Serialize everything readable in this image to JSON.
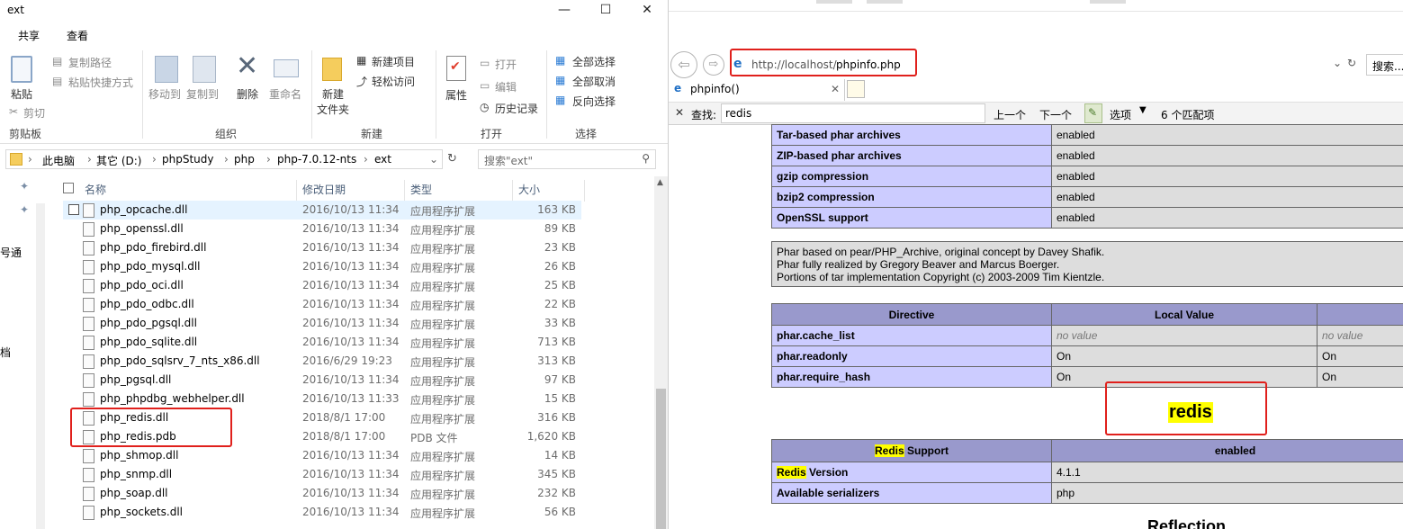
{
  "explorer": {
    "window_title": "ext",
    "window_controls": [
      "—",
      "☐",
      "✕"
    ],
    "ribbon_tabs": [
      "共享",
      "查看"
    ],
    "clipboard": {
      "paste": "粘贴",
      "copy_path": "复制路径",
      "paste_shortcut": "粘贴快捷方式",
      "cut": "剪切",
      "group": "剪贴板"
    },
    "organize": {
      "move_to": "移动到",
      "copy_to": "复制到",
      "delete": "删除",
      "rename": "重命名",
      "group": "组织"
    },
    "new": {
      "new_folder_line1": "新建",
      "new_folder_line2": "文件夹",
      "new_item": "新建项目",
      "easy_access": "轻松访问",
      "group": "新建"
    },
    "open": {
      "properties": "属性",
      "open": "打开",
      "edit": "编辑",
      "history": "历史记录",
      "group": "打开"
    },
    "select": {
      "select_all": "全部选择",
      "select_none": "全部取消",
      "invert": "反向选择",
      "group": "选择"
    },
    "breadcrumb": [
      "此电脑",
      "其它 (D:)",
      "phpStudy",
      "php",
      "php-7.0.12-nts",
      "ext"
    ],
    "search_placeholder": "搜索\"ext\"",
    "nav_fragments": [
      "号通",
      "档"
    ],
    "columns": {
      "name": "名称",
      "date": "修改日期",
      "type": "类型",
      "size": "大小"
    },
    "files": [
      {
        "name": "php_opcache.dll",
        "date": "2016/10/13 11:34",
        "type": "应用程序扩展",
        "size": "163 KB"
      },
      {
        "name": "php_openssl.dll",
        "date": "2016/10/13 11:34",
        "type": "应用程序扩展",
        "size": "89 KB"
      },
      {
        "name": "php_pdo_firebird.dll",
        "date": "2016/10/13 11:34",
        "type": "应用程序扩展",
        "size": "23 KB"
      },
      {
        "name": "php_pdo_mysql.dll",
        "date": "2016/10/13 11:34",
        "type": "应用程序扩展",
        "size": "26 KB"
      },
      {
        "name": "php_pdo_oci.dll",
        "date": "2016/10/13 11:34",
        "type": "应用程序扩展",
        "size": "25 KB"
      },
      {
        "name": "php_pdo_odbc.dll",
        "date": "2016/10/13 11:34",
        "type": "应用程序扩展",
        "size": "22 KB"
      },
      {
        "name": "php_pdo_pgsql.dll",
        "date": "2016/10/13 11:34",
        "type": "应用程序扩展",
        "size": "33 KB"
      },
      {
        "name": "php_pdo_sqlite.dll",
        "date": "2016/10/13 11:34",
        "type": "应用程序扩展",
        "size": "713 KB"
      },
      {
        "name": "php_pdo_sqlsrv_7_nts_x86.dll",
        "date": "2016/6/29 19:23",
        "type": "应用程序扩展",
        "size": "313 KB"
      },
      {
        "name": "php_pgsql.dll",
        "date": "2016/10/13 11:34",
        "type": "应用程序扩展",
        "size": "97 KB"
      },
      {
        "name": "php_phpdbg_webhelper.dll",
        "date": "2016/10/13 11:33",
        "type": "应用程序扩展",
        "size": "15 KB"
      },
      {
        "name": "php_redis.dll",
        "date": "2018/8/1 17:00",
        "type": "应用程序扩展",
        "size": "316 KB"
      },
      {
        "name": "php_redis.pdb",
        "date": "2018/8/1 17:00",
        "type": "PDB 文件",
        "size": "1,620 KB"
      },
      {
        "name": "php_shmop.dll",
        "date": "2016/10/13 11:34",
        "type": "应用程序扩展",
        "size": "14 KB"
      },
      {
        "name": "php_snmp.dll",
        "date": "2016/10/13 11:34",
        "type": "应用程序扩展",
        "size": "345 KB"
      },
      {
        "name": "php_soap.dll",
        "date": "2016/10/13 11:34",
        "type": "应用程序扩展",
        "size": "232 KB"
      },
      {
        "name": "php_sockets.dll",
        "date": "2016/10/13 11:34",
        "type": "应用程序扩展",
        "size": "56 KB"
      }
    ]
  },
  "browser": {
    "url": "http://localhost/phpinfo.php",
    "url_host_part": "http://localhost/",
    "url_path_part": "phpinfo.php",
    "search_box": "搜索...",
    "tab_title": "phpinfo()",
    "find": {
      "label": "查找:",
      "query": "redis",
      "prev": "上一个",
      "next": "下一个",
      "options": "选项",
      "matches": "6 个匹配项"
    },
    "phar_rows": [
      {
        "k": "Tar-based phar archives",
        "v": "enabled"
      },
      {
        "k": "ZIP-based phar archives",
        "v": "enabled"
      },
      {
        "k": "gzip compression",
        "v": "enabled"
      },
      {
        "k": "bzip2 compression",
        "v": "enabled"
      },
      {
        "k": "OpenSSL support",
        "v": "enabled"
      }
    ],
    "phar_credits": [
      "Phar based on pear/PHP_Archive, original concept by Davey Shafik.",
      "Phar fully realized by Gregory Beaver and Marcus Boerger.",
      "Portions of tar implementation Copyright (c) 2003-2009 Tim Kientzle."
    ],
    "directive_header": {
      "directive": "Directive",
      "local": "Local Value"
    },
    "directives": [
      {
        "k": "phar.cache_list",
        "local": "no value",
        "master": "no value"
      },
      {
        "k": "phar.readonly",
        "local": "On",
        "master": "On"
      },
      {
        "k": "phar.require_hash",
        "local": "On",
        "master": "On"
      }
    ],
    "module_heading": "redis",
    "redis_header": {
      "label_hl": "Redis",
      "label_rest": " Support",
      "value": "enabled"
    },
    "redis_rows": [
      {
        "k_hl": "Redis",
        "k_rest": " Version",
        "v": "4.1.1"
      },
      {
        "k_hl": "",
        "k_rest": "Available serializers",
        "v": "php"
      }
    ],
    "next_heading": "Reflection"
  },
  "colors": {
    "highlight": "#ffff00",
    "annotation": "#e0201c",
    "phpinfo_key": "#ccccff",
    "phpinfo_header": "#9999cc",
    "phpinfo_value": "#dddddd"
  }
}
